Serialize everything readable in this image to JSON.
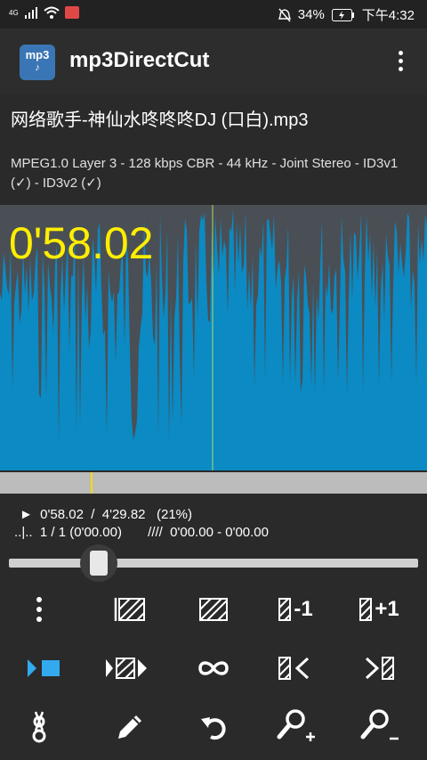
{
  "status": {
    "network": "4G",
    "battery": "34%",
    "time": "下午4:32"
  },
  "app": {
    "icon_text": "mp3",
    "title": "mp3DirectCut"
  },
  "file": {
    "name": "网络歌手-神仙水咚咚咚DJ (口白).mp3",
    "info": "MPEG1.0 Layer 3 - 128 kbps CBR - 44 kHz - Joint Stereo - ID3v1 (✓) - ID3v2 (✓)"
  },
  "editor": {
    "current_time": "0'58.02",
    "position_line": "►  0'58.02  /  4'29.82   (21%)",
    "selection_line": "..|..  1 / 1 (0'00.00)       ////  0'00.00 - 0'00.00",
    "progress_fraction": 0.21
  },
  "colors": {
    "waveform": "#0b8ac3",
    "time_display": "#ffee00",
    "accent": "#33aaee"
  },
  "toolbar_row1": [
    {
      "name": "more-vert-icon"
    },
    {
      "name": "selection-hatch-left-icon"
    },
    {
      "name": "selection-hatch-full-icon"
    },
    {
      "name": "nudge-minus-icon",
      "label": "-1"
    },
    {
      "name": "nudge-plus-icon",
      "label": "+1"
    }
  ],
  "toolbar_row2": [
    {
      "name": "play-stop-icon"
    },
    {
      "name": "play-selection-icon"
    },
    {
      "name": "loop-icon"
    },
    {
      "name": "go-selection-start-icon"
    },
    {
      "name": "go-selection-end-icon"
    }
  ],
  "toolbar_row3": [
    {
      "name": "scissors-icon"
    },
    {
      "name": "pencil-icon"
    },
    {
      "name": "undo-icon"
    },
    {
      "name": "zoom-in-icon"
    },
    {
      "name": "zoom-out-icon"
    }
  ]
}
